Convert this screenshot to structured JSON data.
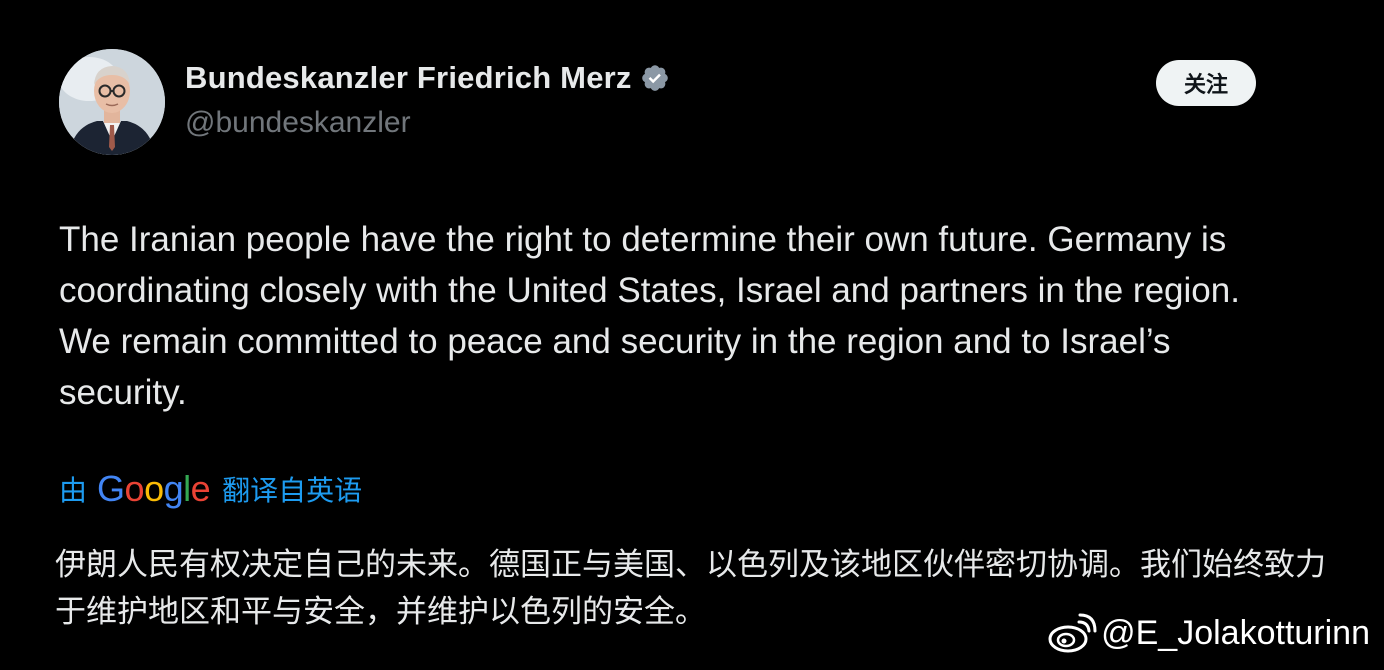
{
  "profile": {
    "display_name": "Bundeskanzler Friedrich Merz",
    "handle": "@bundeskanzler",
    "avatar_icon": "portrait-avatar",
    "verified_icon": "verified-badge-icon",
    "verified_color": "#8b98a5"
  },
  "follow_button": {
    "label": "关注"
  },
  "tweet": {
    "text": "The Iranian people have the right to determine their own future. Germany is coordinating closely with the United States, Israel and partners in the region. We remain committed to peace and security in the region and to Israel’s security."
  },
  "translation": {
    "prefix": "由",
    "provider_logo": "Google",
    "suffix": "翻译自英语",
    "link_color": "#1d9bf0",
    "text": "伊朗人民有权决定自己的未来。德国正与美国、以色列及该地区伙伴密切协调。我们始终致力于维护地区和平与安全，并维护以色列的安全。"
  },
  "watermark": {
    "icon": "weibo-icon",
    "text": "@E_Jolakotturinn"
  }
}
